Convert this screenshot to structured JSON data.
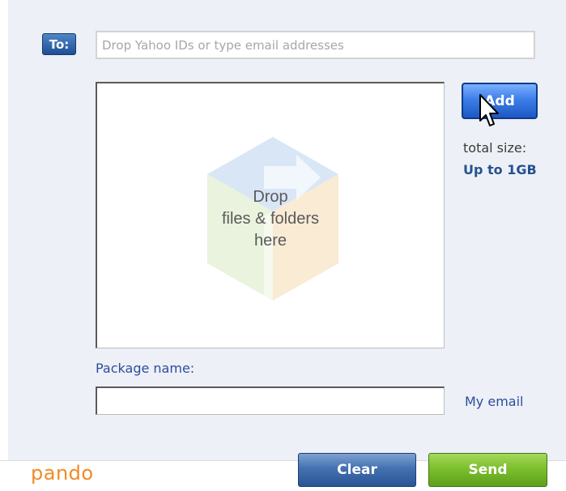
{
  "compose": {
    "to_label": "To:",
    "to_placeholder": "Drop Yahoo IDs or type email addresses",
    "to_value": ""
  },
  "drop_zone": {
    "line1": "Drop",
    "line2": "files & folders",
    "line3": "here",
    "icon": "folder-cube-icon"
  },
  "side": {
    "add_label": "Add",
    "total_size_label": "total size:",
    "total_size_value": "Up to 1GB"
  },
  "package": {
    "label": "Package name:",
    "value": "",
    "my_email_link": "My email"
  },
  "footer": {
    "logo_text": "pando",
    "clear_label": "Clear",
    "send_label": "Send"
  },
  "colors": {
    "panel_bg": "#eef0f7",
    "link_blue": "#2a4f9a",
    "logo_orange": "#f08a24",
    "send_green": "#7cbf2e",
    "clear_blue": "#4471b2"
  }
}
